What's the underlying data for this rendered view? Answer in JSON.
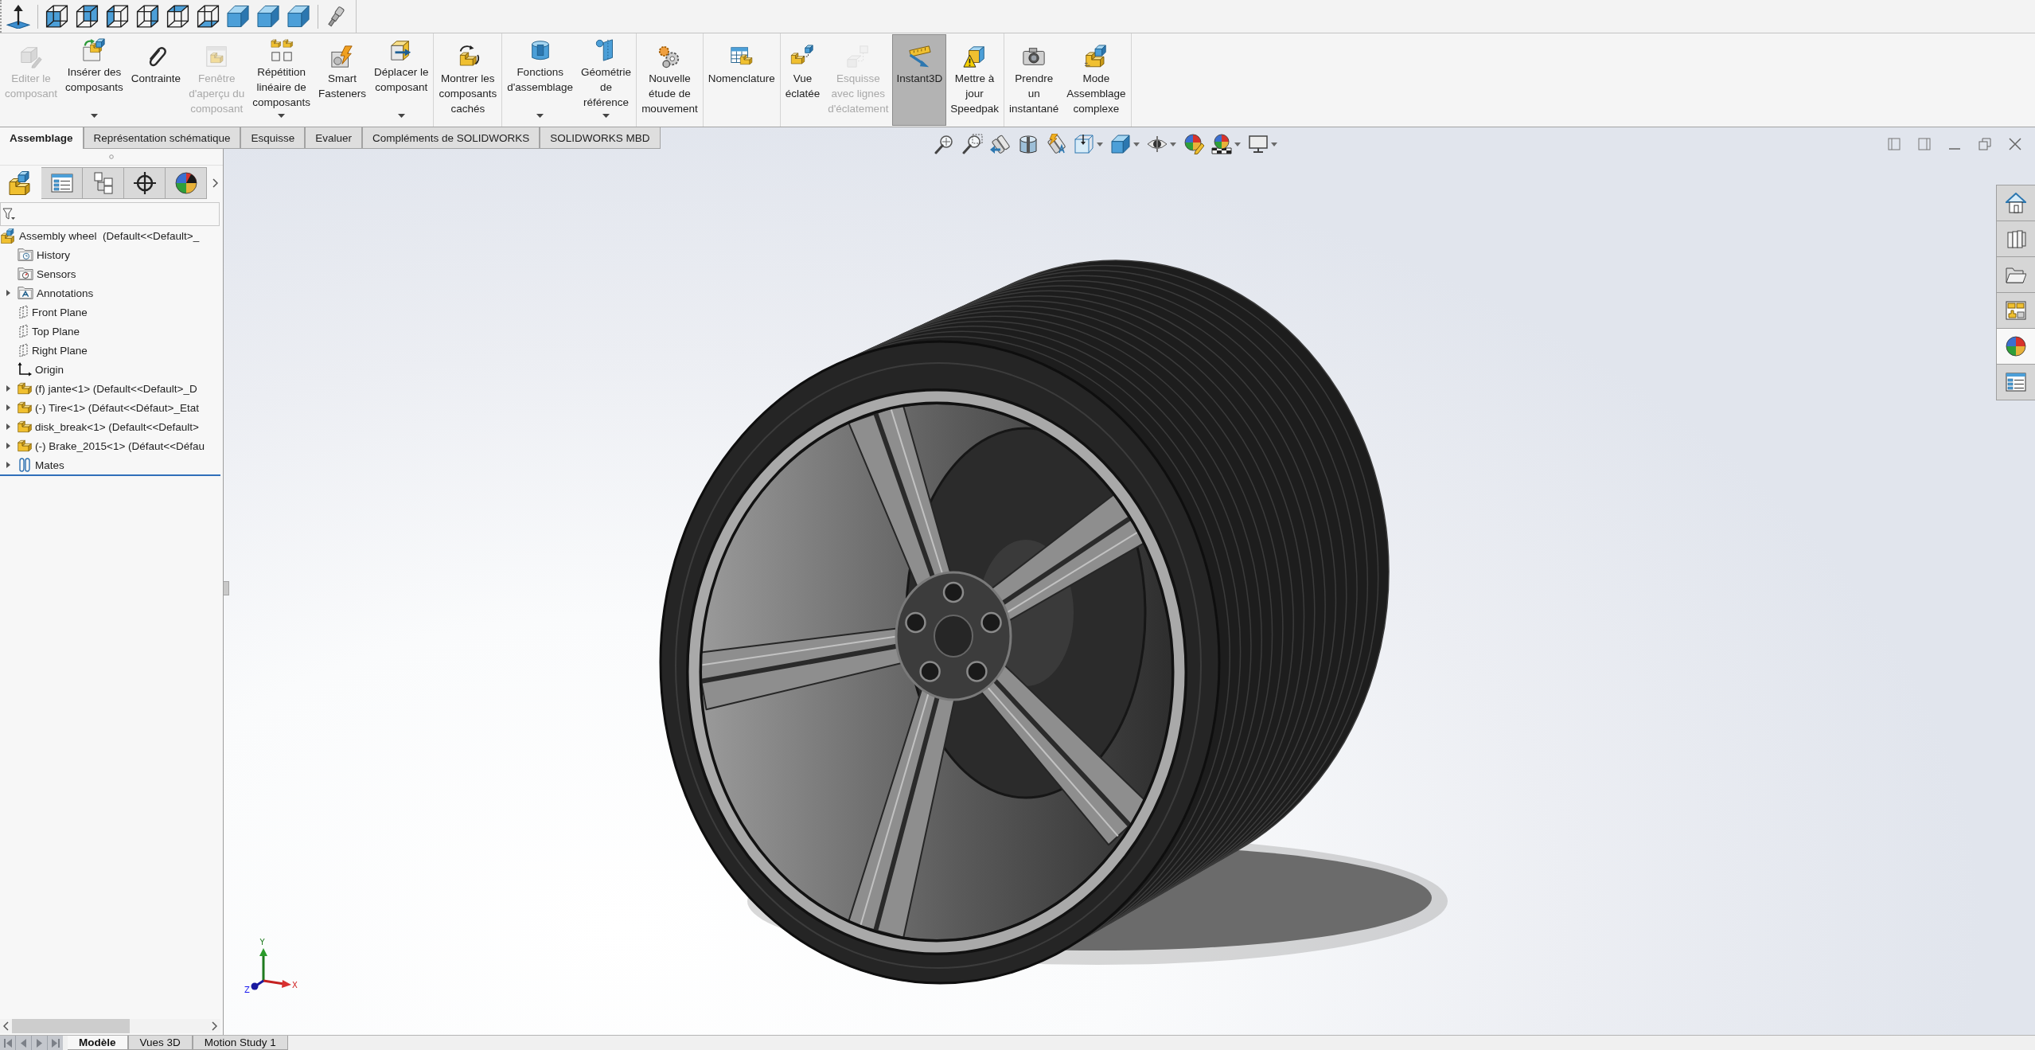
{
  "ribbon": {
    "groups": [
      [
        {
          "label": "Editer le\ncomposant",
          "disabled": true,
          "dropdown": false,
          "selected": false
        },
        {
          "label": "Insérer des\ncomposants",
          "disabled": false,
          "dropdown": true,
          "selected": false
        },
        {
          "label": "Contrainte",
          "disabled": false,
          "dropdown": false,
          "selected": false
        },
        {
          "label": "Fenêtre\nd'aperçu du\ncomposant",
          "disabled": true,
          "dropdown": false,
          "selected": false
        },
        {
          "label": "Répétition\nlinéaire de\ncomposants",
          "disabled": false,
          "dropdown": true,
          "selected": false
        },
        {
          "label": "Smart\nFasteners",
          "disabled": false,
          "dropdown": false,
          "selected": false
        },
        {
          "label": "Déplacer le\ncomposant",
          "disabled": false,
          "dropdown": true,
          "selected": false
        }
      ],
      [
        {
          "label": "Montrer les\ncomposants\ncachés",
          "disabled": false,
          "dropdown": false,
          "selected": false
        }
      ],
      [
        {
          "label": "Fonctions\nd'assemblage",
          "disabled": false,
          "dropdown": true,
          "selected": false
        },
        {
          "label": "Géométrie\nde\nréférence",
          "disabled": false,
          "dropdown": true,
          "selected": false
        }
      ],
      [
        {
          "label": "Nouvelle\nétude de\nmouvement",
          "disabled": false,
          "dropdown": false,
          "selected": false
        }
      ],
      [
        {
          "label": "Nomenclature",
          "disabled": false,
          "dropdown": false,
          "selected": false
        }
      ],
      [
        {
          "label": "Vue\néclatée",
          "disabled": false,
          "dropdown": false,
          "selected": false
        },
        {
          "label": "Esquisse\navec lignes\nd'éclatement",
          "disabled": true,
          "dropdown": false,
          "selected": false
        },
        {
          "label": "Instant3D",
          "disabled": false,
          "dropdown": false,
          "selected": true
        },
        {
          "label": "Mettre à\njour\nSpeedpak",
          "disabled": false,
          "dropdown": false,
          "selected": false
        }
      ],
      [
        {
          "label": "Prendre\nun\ninstantané",
          "disabled": false,
          "dropdown": false,
          "selected": false
        },
        {
          "label": "Mode\nAssemblage\ncomplexe",
          "disabled": false,
          "dropdown": false,
          "selected": false
        }
      ]
    ]
  },
  "tabs": [
    {
      "label": "Assemblage",
      "selected": true
    },
    {
      "label": "Représentation schématique",
      "selected": false
    },
    {
      "label": "Esquisse",
      "selected": false
    },
    {
      "label": "Evaluer",
      "selected": false
    },
    {
      "label": "Compléments de SOLIDWORKS",
      "selected": false
    },
    {
      "label": "SOLIDWORKS MBD",
      "selected": false
    }
  ],
  "feature_manager": {
    "panel_tabs": [
      {
        "selected": true
      },
      {
        "selected": false
      },
      {
        "selected": false
      },
      {
        "selected": false
      },
      {
        "selected": false
      }
    ],
    "tree": [
      {
        "label": "Assembly wheel  (Default<<Default>_",
        "kind": "assembly",
        "expandable": false,
        "children": [
          {
            "label": "History",
            "kind": "history",
            "expandable": false
          },
          {
            "label": "Sensors",
            "kind": "sensors",
            "expandable": false
          },
          {
            "label": "Annotations",
            "kind": "annotations",
            "expandable": true
          },
          {
            "label": "Front Plane",
            "kind": "plane",
            "expandable": false
          },
          {
            "label": "Top Plane",
            "kind": "plane",
            "expandable": false
          },
          {
            "label": "Right Plane",
            "kind": "plane",
            "expandable": false
          },
          {
            "label": "Origin",
            "kind": "origin",
            "expandable": false
          },
          {
            "label": "(f) jante<1> (Default<<Default>_D",
            "kind": "part",
            "expandable": true
          },
          {
            "label": "(-) Tire<1> (Défaut<<Défaut>_Etat",
            "kind": "part",
            "expandable": true
          },
          {
            "label": "disk_break<1> (Default<<Default>",
            "kind": "part",
            "expandable": true
          },
          {
            "label": "(-) Brake_2015<1> (Défaut<<Défau",
            "kind": "part",
            "expandable": true
          },
          {
            "label": "Mates",
            "kind": "mates",
            "expandable": true
          }
        ]
      }
    ]
  },
  "viewport": {
    "task_pane_tabs": [
      {
        "selected": false
      },
      {
        "selected": false
      },
      {
        "selected": false
      },
      {
        "selected": false
      },
      {
        "selected": true
      },
      {
        "selected": false
      }
    ],
    "triad": {
      "x": "X",
      "y": "Y",
      "z": "Z"
    }
  },
  "bottom_tabs": [
    {
      "label": "Modèle",
      "selected": true
    },
    {
      "label": "Vues 3D",
      "selected": false
    },
    {
      "label": "Motion Study 1",
      "selected": false
    }
  ]
}
